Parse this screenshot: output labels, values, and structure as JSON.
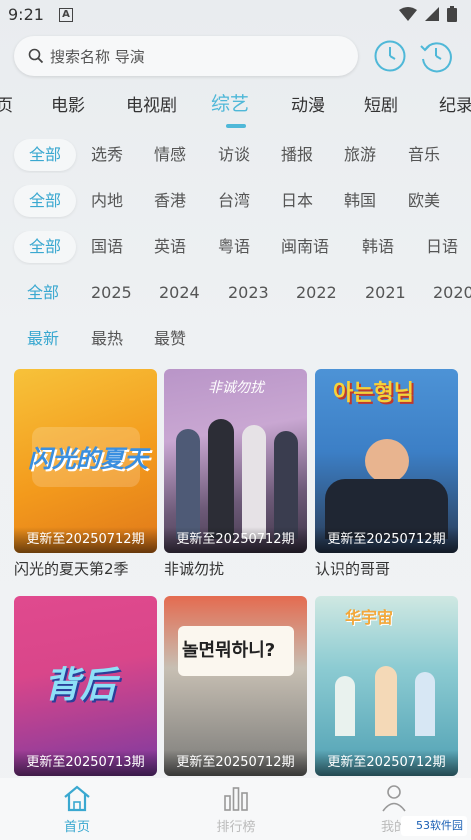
{
  "status": {
    "time": "9:21",
    "notif_letter": "A"
  },
  "search": {
    "placeholder": "搜索名称 导演"
  },
  "nav_tabs": [
    "页",
    "电影",
    "电视剧",
    "综艺",
    "动漫",
    "短剧",
    "纪录"
  ],
  "active_tab": "综艺",
  "filters": {
    "genre": [
      "全部",
      "选秀",
      "情感",
      "访谈",
      "播报",
      "旅游",
      "音乐"
    ],
    "region": [
      "全部",
      "内地",
      "香港",
      "台湾",
      "日本",
      "韩国",
      "欧美"
    ],
    "language": [
      "全部",
      "国语",
      "英语",
      "粤语",
      "闽南语",
      "韩语",
      "日语"
    ],
    "year": [
      "全部",
      "2025",
      "2024",
      "2023",
      "2022",
      "2021",
      "2020"
    ],
    "sort": [
      "最新",
      "最热",
      "最赞"
    ]
  },
  "cards": [
    {
      "title": "闪光的夏天第2季",
      "badge": "更新至20250712期",
      "poster_text": "闪光的夏天"
    },
    {
      "title": "非诚勿扰",
      "badge": "更新至20250712期",
      "poster_text": "非诚勿扰"
    },
    {
      "title": "认识的哥哥",
      "badge": "更新至20250712期",
      "poster_text": "아는형님"
    },
    {
      "title": "",
      "badge": "更新至20250713期",
      "poster_text": "背后"
    },
    {
      "title": "",
      "badge": "更新至20250712期",
      "poster_text": "놀면뭐하니?"
    },
    {
      "title": "",
      "badge": "更新至20250712期",
      "poster_text": "华宇宙"
    }
  ],
  "bottom_nav": [
    "首页",
    "排行榜",
    "我的"
  ],
  "watermark": "53软件园",
  "colors": {
    "accent": "#4fb8d8"
  }
}
